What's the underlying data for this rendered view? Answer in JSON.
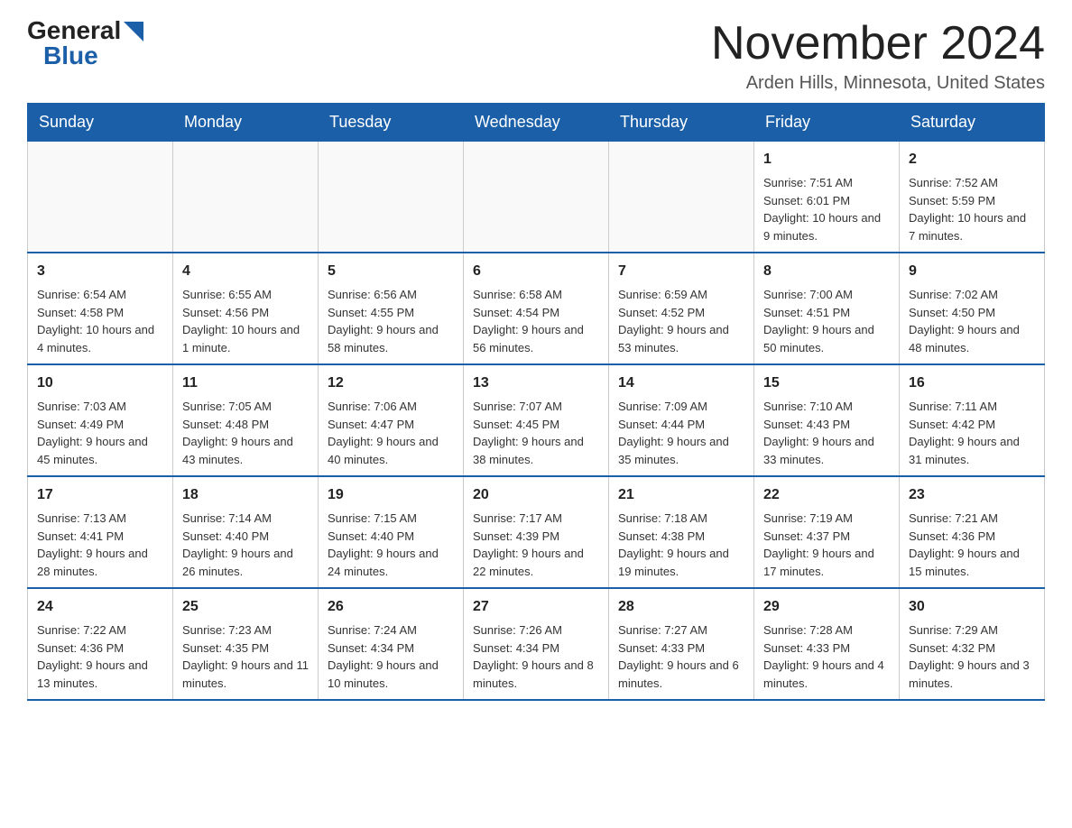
{
  "logo": {
    "general": "General",
    "blue": "Blue",
    "arrow": "▶"
  },
  "title": "November 2024",
  "location": "Arden Hills, Minnesota, United States",
  "days_of_week": [
    "Sunday",
    "Monday",
    "Tuesday",
    "Wednesday",
    "Thursday",
    "Friday",
    "Saturday"
  ],
  "weeks": [
    [
      {
        "day": "",
        "info": ""
      },
      {
        "day": "",
        "info": ""
      },
      {
        "day": "",
        "info": ""
      },
      {
        "day": "",
        "info": ""
      },
      {
        "day": "",
        "info": ""
      },
      {
        "day": "1",
        "info": "Sunrise: 7:51 AM\nSunset: 6:01 PM\nDaylight: 10 hours and 9 minutes."
      },
      {
        "day": "2",
        "info": "Sunrise: 7:52 AM\nSunset: 5:59 PM\nDaylight: 10 hours and 7 minutes."
      }
    ],
    [
      {
        "day": "3",
        "info": "Sunrise: 6:54 AM\nSunset: 4:58 PM\nDaylight: 10 hours and 4 minutes."
      },
      {
        "day": "4",
        "info": "Sunrise: 6:55 AM\nSunset: 4:56 PM\nDaylight: 10 hours and 1 minute."
      },
      {
        "day": "5",
        "info": "Sunrise: 6:56 AM\nSunset: 4:55 PM\nDaylight: 9 hours and 58 minutes."
      },
      {
        "day": "6",
        "info": "Sunrise: 6:58 AM\nSunset: 4:54 PM\nDaylight: 9 hours and 56 minutes."
      },
      {
        "day": "7",
        "info": "Sunrise: 6:59 AM\nSunset: 4:52 PM\nDaylight: 9 hours and 53 minutes."
      },
      {
        "day": "8",
        "info": "Sunrise: 7:00 AM\nSunset: 4:51 PM\nDaylight: 9 hours and 50 minutes."
      },
      {
        "day": "9",
        "info": "Sunrise: 7:02 AM\nSunset: 4:50 PM\nDaylight: 9 hours and 48 minutes."
      }
    ],
    [
      {
        "day": "10",
        "info": "Sunrise: 7:03 AM\nSunset: 4:49 PM\nDaylight: 9 hours and 45 minutes."
      },
      {
        "day": "11",
        "info": "Sunrise: 7:05 AM\nSunset: 4:48 PM\nDaylight: 9 hours and 43 minutes."
      },
      {
        "day": "12",
        "info": "Sunrise: 7:06 AM\nSunset: 4:47 PM\nDaylight: 9 hours and 40 minutes."
      },
      {
        "day": "13",
        "info": "Sunrise: 7:07 AM\nSunset: 4:45 PM\nDaylight: 9 hours and 38 minutes."
      },
      {
        "day": "14",
        "info": "Sunrise: 7:09 AM\nSunset: 4:44 PM\nDaylight: 9 hours and 35 minutes."
      },
      {
        "day": "15",
        "info": "Sunrise: 7:10 AM\nSunset: 4:43 PM\nDaylight: 9 hours and 33 minutes."
      },
      {
        "day": "16",
        "info": "Sunrise: 7:11 AM\nSunset: 4:42 PM\nDaylight: 9 hours and 31 minutes."
      }
    ],
    [
      {
        "day": "17",
        "info": "Sunrise: 7:13 AM\nSunset: 4:41 PM\nDaylight: 9 hours and 28 minutes."
      },
      {
        "day": "18",
        "info": "Sunrise: 7:14 AM\nSunset: 4:40 PM\nDaylight: 9 hours and 26 minutes."
      },
      {
        "day": "19",
        "info": "Sunrise: 7:15 AM\nSunset: 4:40 PM\nDaylight: 9 hours and 24 minutes."
      },
      {
        "day": "20",
        "info": "Sunrise: 7:17 AM\nSunset: 4:39 PM\nDaylight: 9 hours and 22 minutes."
      },
      {
        "day": "21",
        "info": "Sunrise: 7:18 AM\nSunset: 4:38 PM\nDaylight: 9 hours and 19 minutes."
      },
      {
        "day": "22",
        "info": "Sunrise: 7:19 AM\nSunset: 4:37 PM\nDaylight: 9 hours and 17 minutes."
      },
      {
        "day": "23",
        "info": "Sunrise: 7:21 AM\nSunset: 4:36 PM\nDaylight: 9 hours and 15 minutes."
      }
    ],
    [
      {
        "day": "24",
        "info": "Sunrise: 7:22 AM\nSunset: 4:36 PM\nDaylight: 9 hours and 13 minutes."
      },
      {
        "day": "25",
        "info": "Sunrise: 7:23 AM\nSunset: 4:35 PM\nDaylight: 9 hours and 11 minutes."
      },
      {
        "day": "26",
        "info": "Sunrise: 7:24 AM\nSunset: 4:34 PM\nDaylight: 9 hours and 10 minutes."
      },
      {
        "day": "27",
        "info": "Sunrise: 7:26 AM\nSunset: 4:34 PM\nDaylight: 9 hours and 8 minutes."
      },
      {
        "day": "28",
        "info": "Sunrise: 7:27 AM\nSunset: 4:33 PM\nDaylight: 9 hours and 6 minutes."
      },
      {
        "day": "29",
        "info": "Sunrise: 7:28 AM\nSunset: 4:33 PM\nDaylight: 9 hours and 4 minutes."
      },
      {
        "day": "30",
        "info": "Sunrise: 7:29 AM\nSunset: 4:32 PM\nDaylight: 9 hours and 3 minutes."
      }
    ]
  ]
}
